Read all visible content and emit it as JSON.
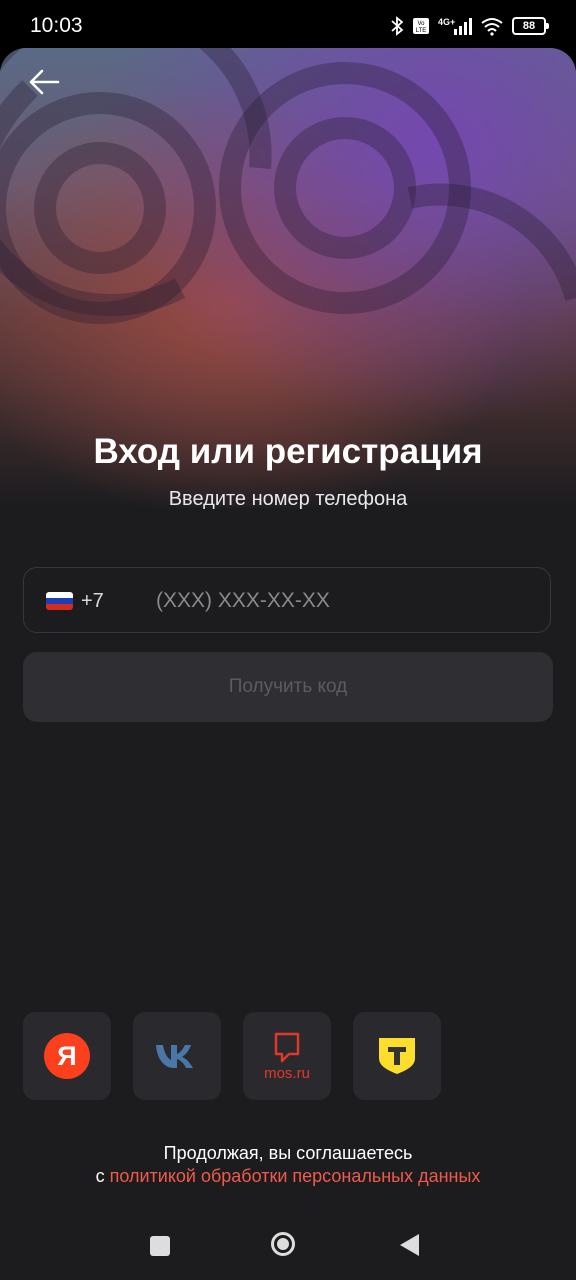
{
  "status_bar": {
    "time": "10:03",
    "battery": "88",
    "icons": [
      "bluetooth-icon",
      "volte-icon",
      "signal-4g-icon",
      "wifi-icon",
      "battery-icon"
    ]
  },
  "header": {
    "back_icon": "arrow-left-icon"
  },
  "main": {
    "title": "Вход или регистрация",
    "subtitle": "Введите номер телефона",
    "phone": {
      "country_flag": "russia-flag-icon",
      "country_code": "+7",
      "value": "",
      "placeholder": "(XXX) XXX-XX-XX"
    },
    "get_code_label": "Получить код"
  },
  "social_login": {
    "items": [
      {
        "name": "yandex",
        "icon": "yandex-icon",
        "label": "Я"
      },
      {
        "name": "vk",
        "icon": "vk-icon"
      },
      {
        "name": "mosru",
        "icon": "mosru-icon",
        "label": "mos.ru"
      },
      {
        "name": "tbank",
        "icon": "tbank-icon",
        "label": "Т"
      }
    ]
  },
  "legal": {
    "line1": "Продолжая, вы соглашаетесь",
    "line2_prefix": "с ",
    "link_text": "политикой обработки персональных данных"
  },
  "colors": {
    "background": "#1c1c1f",
    "accent_link": "#f05a4b",
    "yandex_red": "#fc3f1d",
    "vk_blue": "#4a76a8",
    "mosru_red": "#e4372b",
    "tbank_yellow": "#ffdd2d"
  }
}
